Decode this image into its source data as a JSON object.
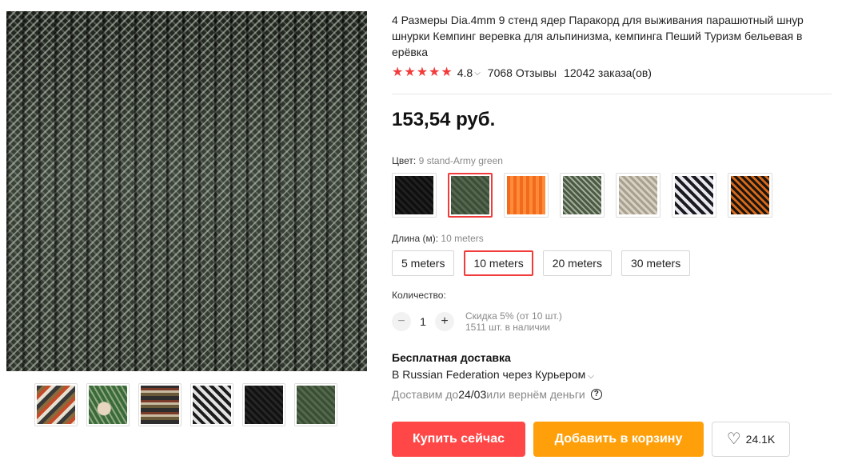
{
  "product": {
    "title": "4 Размеры Dia.4mm 9 стенд ядер Паракорд для выживания парашютный шнур шнурки Кемпинг веревка для альпинизма, кемпинга Пеший Туризм бельевая в ерёвка",
    "rating": "4.8",
    "star_count": 5,
    "reviews": "7068 Отзывы",
    "orders": "12042 заказа(ов)",
    "price": "153,54 руб."
  },
  "gallery": {
    "thumbnail_count": 6
  },
  "color": {
    "label": "Цвет: ",
    "selected": "9 stand-Army green",
    "swatch_count": 7,
    "selected_index": 1
  },
  "length": {
    "label": "Длина (м): ",
    "selected": "10 meters",
    "options": [
      "5 meters",
      "10 meters",
      "20 meters",
      "30 meters"
    ]
  },
  "quantity": {
    "label": "Количество:",
    "minus": "−",
    "value": "1",
    "plus": "+",
    "discount": "Скидка 5% (от 10 шт.)",
    "stock": "1511 шт. в наличии"
  },
  "shipping": {
    "title": "Бесплатная доставка",
    "destination": "В Russian Federation через Курьером",
    "delivery_prefix": "Доставим до ",
    "delivery_date": "24/03",
    "delivery_suffix": " или вернём деньги",
    "help": "?"
  },
  "actions": {
    "buy_now": "Купить сейчас",
    "add_to_cart": "Добавить в корзину",
    "wishlist_count": "24.1K"
  },
  "colors": {
    "accent_red": "#ff4747",
    "cart_orange": "#ffa00a",
    "star": "#f23b3b"
  },
  "icons": {
    "star": "star-icon",
    "chevron": "chevron-down-icon",
    "heart": "heart-icon",
    "help": "help-circle-icon"
  }
}
